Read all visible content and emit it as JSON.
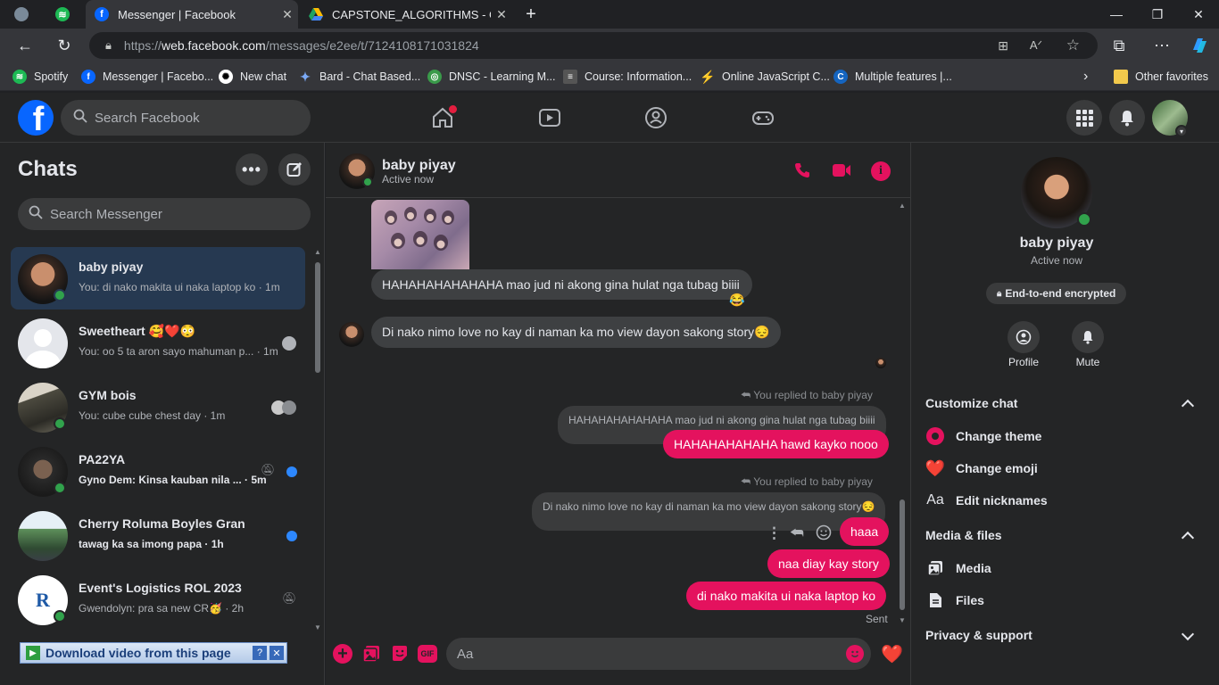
{
  "browser": {
    "tabs": [
      {
        "title": "",
        "icon": "profile-avatar-icon"
      },
      {
        "title": "",
        "icon": "spotify-icon"
      },
      {
        "title": "Messenger | Facebook",
        "icon": "facebook-icon"
      },
      {
        "title": "CAPSTONE_ALGORITHMS - Goo",
        "icon": "google-drive-icon"
      }
    ],
    "url": {
      "scheme": "https://",
      "host": "web.facebook.com",
      "path": "/messages/e2ee/t/7124108171031824"
    },
    "bookmarks": [
      {
        "label": "Spotify"
      },
      {
        "label": "Messenger | Facebo..."
      },
      {
        "label": "New chat"
      },
      {
        "label": "Bard - Chat Based..."
      },
      {
        "label": "DNSC - Learning M..."
      },
      {
        "label": "Course: Information..."
      },
      {
        "label": "Online JavaScript C..."
      },
      {
        "label": "Multiple features |..."
      }
    ],
    "other_favorites": "Other favorites"
  },
  "facebook": {
    "search_placeholder": "Search Facebook",
    "accent": "#e4125e",
    "brand": "#0866ff"
  },
  "chats": {
    "title": "Chats",
    "search_placeholder": "Search Messenger",
    "items": [
      {
        "name": "baby piyay",
        "preview": "You: di nako makita ui naka laptop ko · 1m",
        "selected": true,
        "online": true
      },
      {
        "name": "Sweetheart 🥰❤️😳",
        "preview": "You: oo 5 ta aron sayo mahuman p... · 1m",
        "online": false
      },
      {
        "name": "GYM bois",
        "preview": "You: cube cube chest day · 1m",
        "online": true
      },
      {
        "name": "PA22YA",
        "preview": "Gyno Dem: Kinsa kauban nila ... · 5m",
        "unread": true,
        "online": true
      },
      {
        "name": "Cherry Roluma Boyles Gran",
        "preview": "tawag ka sa imong papa · 1h",
        "unread": true,
        "online": false
      },
      {
        "name": "Event's Logistics ROL 2023",
        "preview": "Gwendolyn: pra sa new CR🥳 · 2h",
        "online": true
      }
    ],
    "download_bar": "Download video from this page"
  },
  "conversation": {
    "name": "baby piyay",
    "status": "Active now",
    "messages": {
      "m1": "HAHAHAHAHAHAHA mao jud ni akong gina hulat nga tubag biiii",
      "m1_reaction": "😂",
      "m2": "Di nako nimo love no kay di naman ka mo view dayon sakong story😔",
      "reply1_note": "You replied to baby piyay",
      "reply1_quote": "HAHAHAHAHAHAHA mao jud ni akong gina hulat nga tubag biiii",
      "reply1_msg": "HAHAHAHAHAHA hawd kayko nooo",
      "reply2_note": "You replied to baby piyay",
      "reply2_quote": "Di nako nimo love no kay di naman ka mo view dayon sakong story😔",
      "reply2_msg": "haaa",
      "m3": "naa diay kay story",
      "m4": "di nako makita ui naka laptop ko",
      "sent": "Sent"
    },
    "composer_placeholder": "Aa"
  },
  "info": {
    "name": "baby piyay",
    "status": "Active now",
    "encrypted": "End-to-end encrypted",
    "profile": "Profile",
    "mute": "Mute",
    "customize": "Customize chat",
    "change_theme": "Change theme",
    "change_emoji": "Change emoji",
    "edit_nicknames": "Edit nicknames",
    "media_files": "Media & files",
    "media": "Media",
    "files": "Files",
    "privacy": "Privacy & support",
    "emoji_value": "❤️"
  }
}
